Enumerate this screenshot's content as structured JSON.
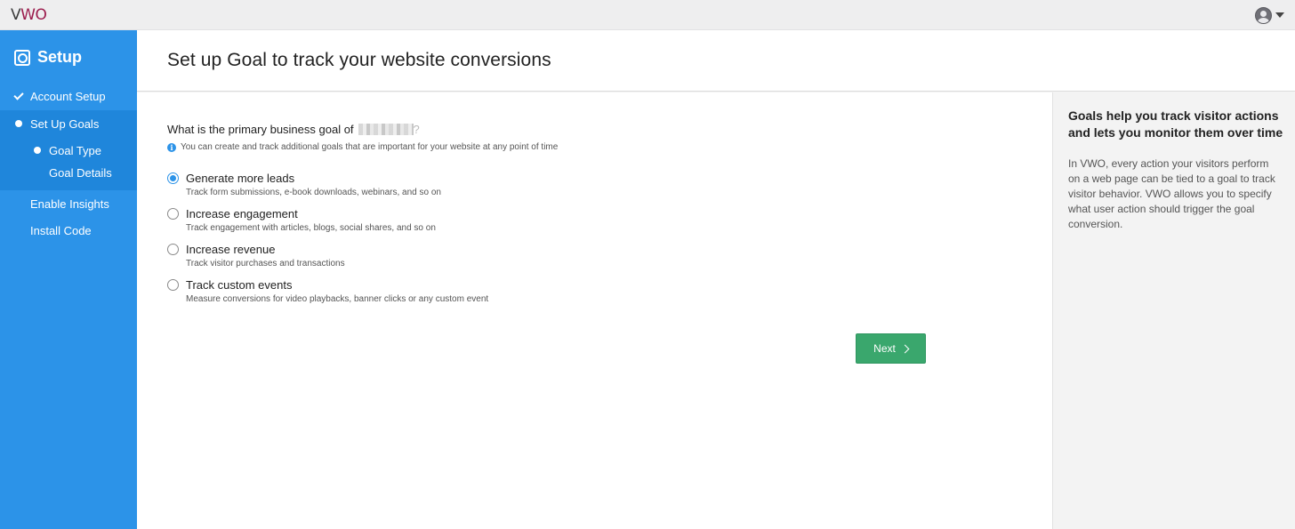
{
  "app": {
    "logo_text": "VWO",
    "brand_color": "#9b1b4c"
  },
  "topbar": {
    "user_icon": "user-avatar-icon",
    "menu_icon": "caret-down-icon"
  },
  "sidebar": {
    "title": "Setup",
    "title_icon": "setup-icon",
    "background": "#2c93e8",
    "items": [
      {
        "label": "Account Setup",
        "state": "completed",
        "icon": "check-icon"
      },
      {
        "label": "Set Up Goals",
        "state": "active",
        "icon": "dot-icon"
      },
      {
        "label": "Enable Insights",
        "state": "pending"
      },
      {
        "label": "Install Code",
        "state": "pending"
      }
    ],
    "sub_items": [
      {
        "label": "Goal Type",
        "state": "active",
        "icon": "dot-icon"
      },
      {
        "label": "Goal Details",
        "state": "pending"
      }
    ]
  },
  "header": {
    "title": "Set up Goal to track your website conversions"
  },
  "main": {
    "question": "What is the primary business goal of",
    "question_suffix": "?",
    "info_text": "You can create and track additional goals that are important for your website at any point of time",
    "options": [
      {
        "label": "Generate more leads",
        "description": "Track form submissions, e-book downloads, webinars, and so on",
        "selected": true
      },
      {
        "label": "Increase engagement",
        "description": "Track engagement with articles, blogs, social shares, and so on",
        "selected": false
      },
      {
        "label": "Increase revenue",
        "description": "Track visitor purchases and transactions",
        "selected": false
      },
      {
        "label": "Track custom events",
        "description": "Measure conversions for video playbacks, banner clicks or any custom event",
        "selected": false
      }
    ],
    "next_label": "Next",
    "next_color": "#3aa76d"
  },
  "aside": {
    "title": "Goals help you track visitor actions and lets you monitor them over time",
    "text": "In VWO, every action your visitors perform on a web page can be tied to a goal to track visitor behavior. VWO allows you to specify what user action should trigger the goal conversion."
  }
}
